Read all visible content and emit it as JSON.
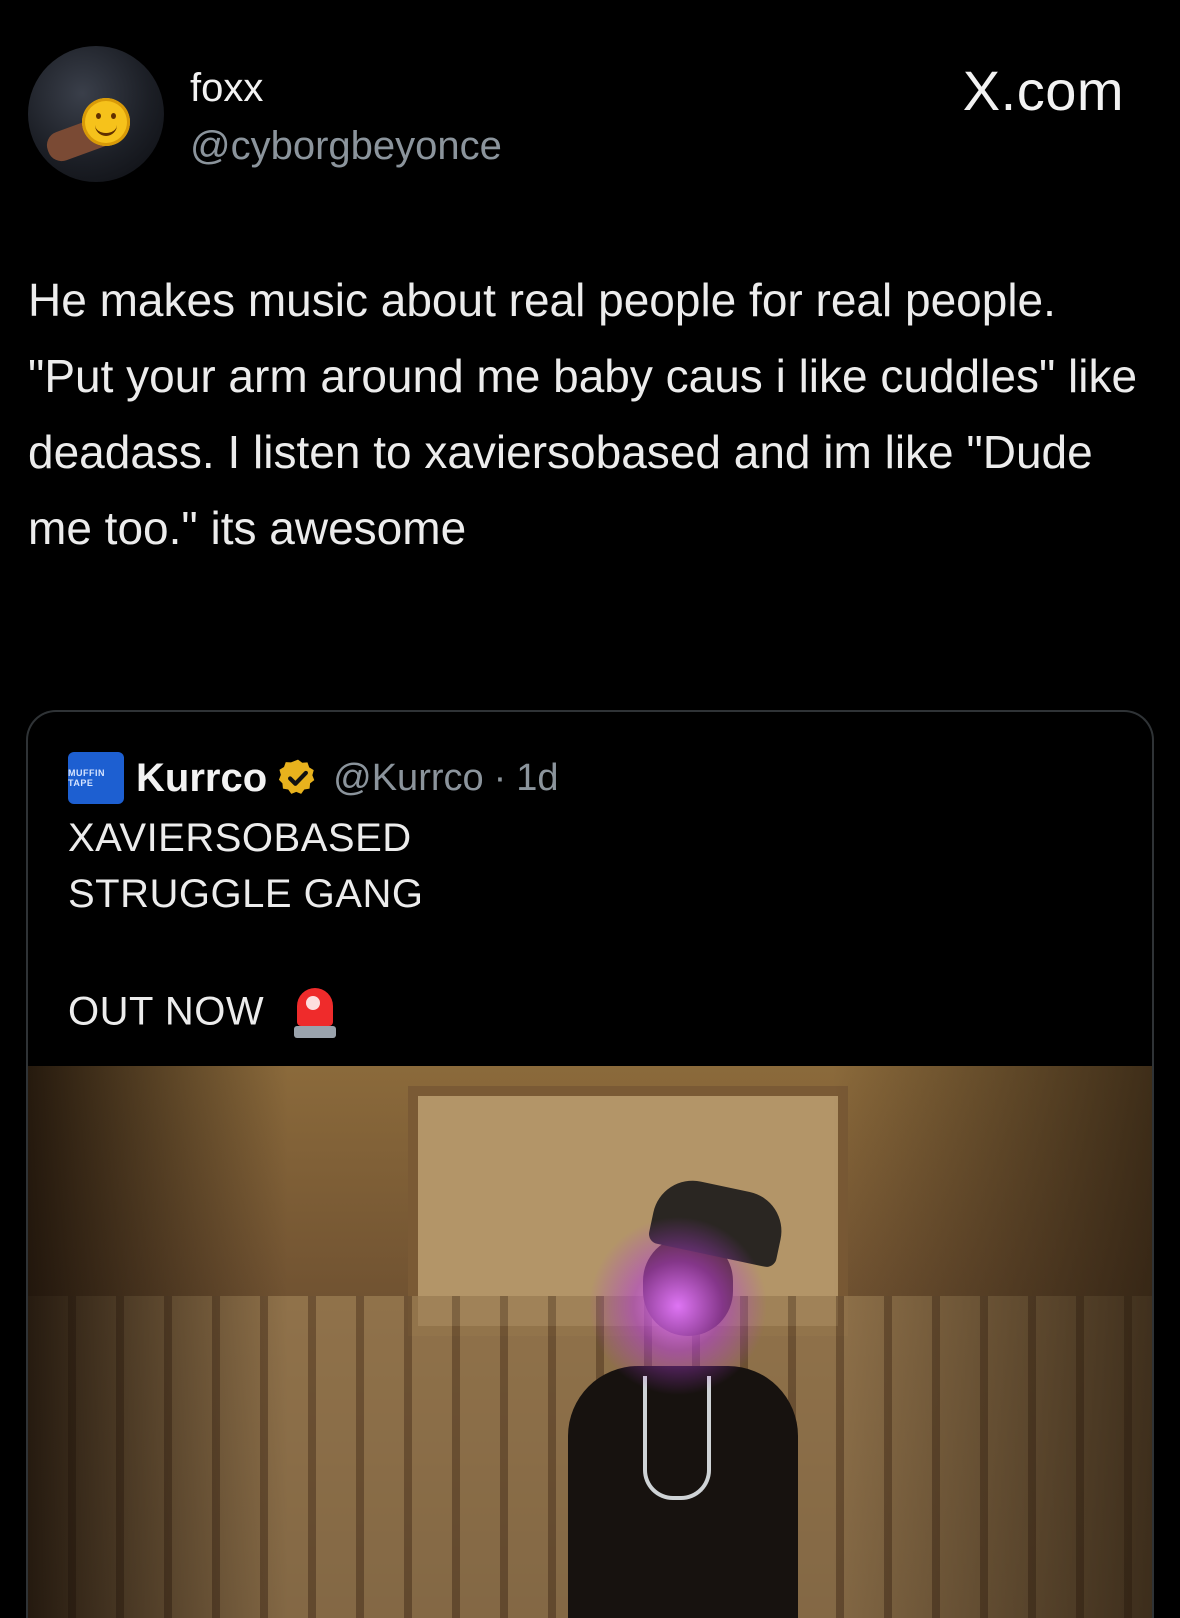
{
  "author": {
    "display_name": "foxx",
    "handle": "@cyborgbeyonce"
  },
  "brand": {
    "label": "X.com"
  },
  "tweet": {
    "text": "He makes music about real people for real people. \"Put your arm around me baby caus i like cuddles\" like deadass. I listen to xaviersobased and im like \"Dude me too.\" its awesome"
  },
  "quoted_tweet": {
    "avatar_label": "MUFFIN TAPE",
    "display_name": "Kurrco",
    "verified_icon": "verified-badge-icon",
    "handle": "@Kurrco",
    "separator": "·",
    "age": "1d",
    "lines": [
      "XAVIERSOBASED",
      "STRUGGLE GANG",
      "OUT NOW"
    ],
    "emoji_icon": "police-light-icon"
  },
  "colors": {
    "background": "#000000",
    "text_primary": "#ececec",
    "text_secondary": "#8b949c",
    "verified_gold": "#e8b21d",
    "card_border": "#2f3336"
  }
}
